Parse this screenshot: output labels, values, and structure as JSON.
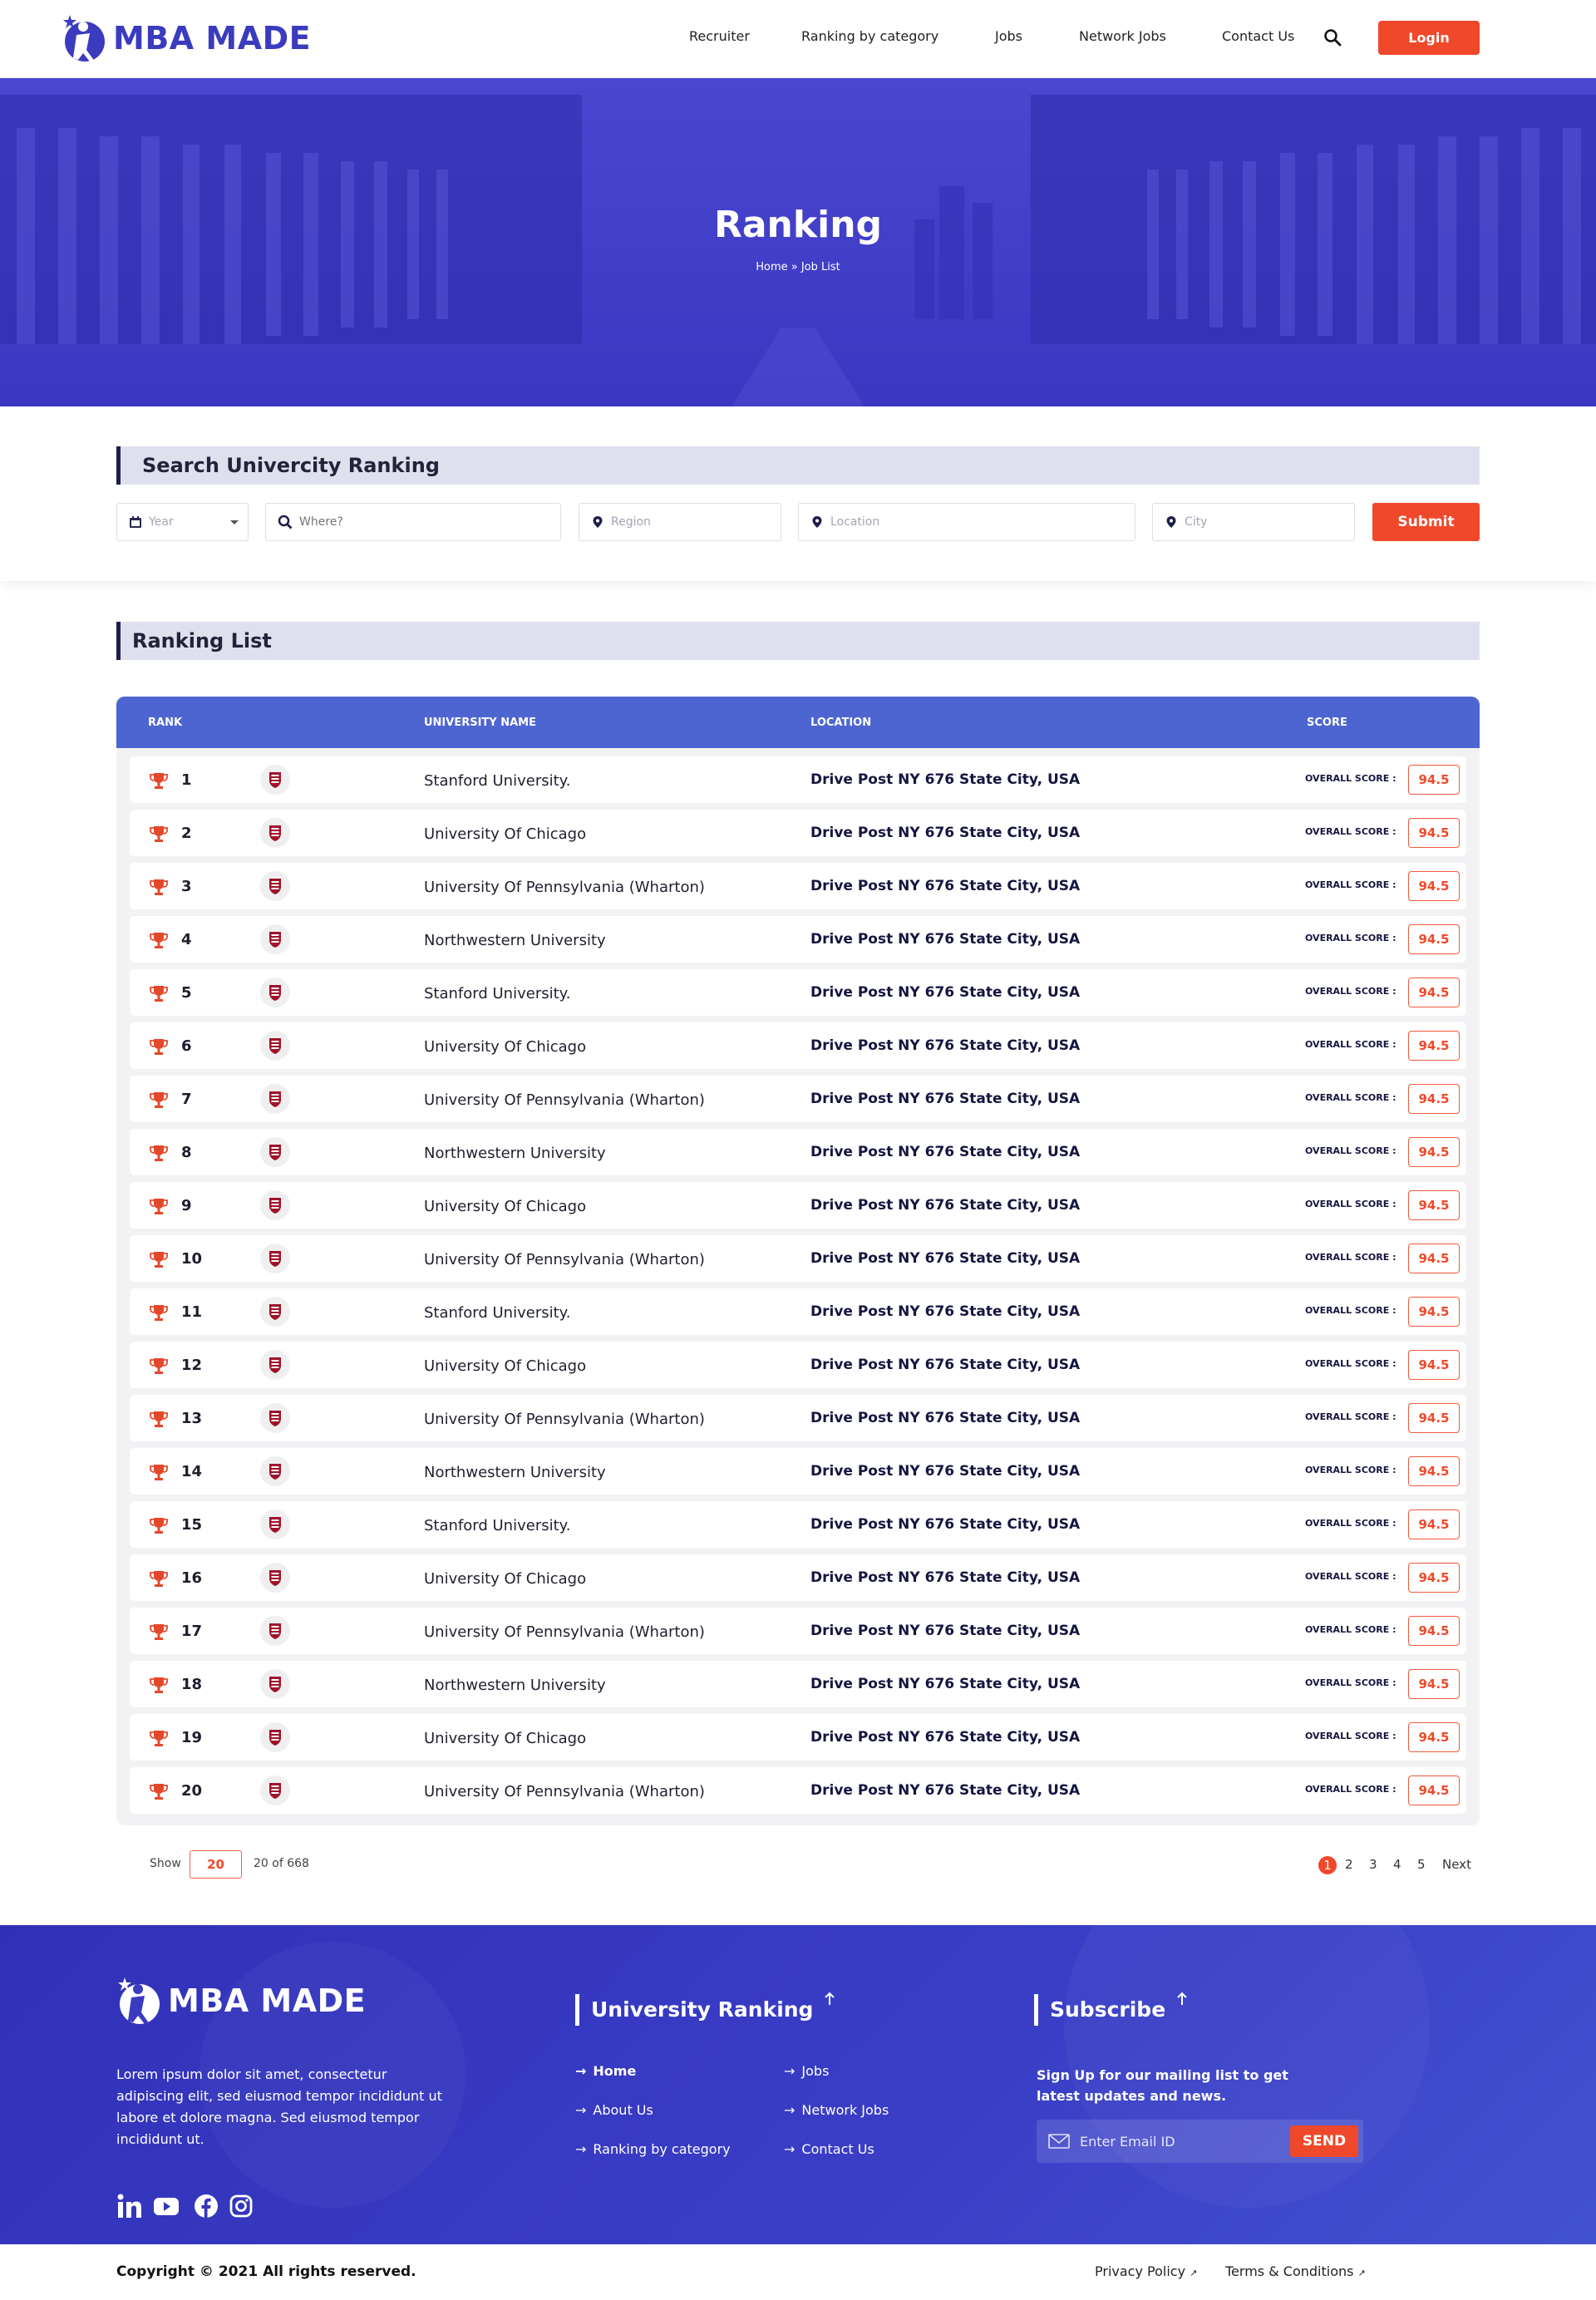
{
  "header": {
    "logo_text": "MBA MADE",
    "nav": [
      "Recruiter",
      "Ranking  by category",
      "Jobs",
      "Network Jobs",
      "Contact Us"
    ],
    "login_label": "Login"
  },
  "hero": {
    "title": "Ranking",
    "breadcrumb": "Home » Job List"
  },
  "search": {
    "title": "Search Univercity Ranking",
    "year_placeholder": "Year",
    "where_placeholder": "Where?",
    "region_placeholder": "Region",
    "location_placeholder": "Location",
    "city_placeholder": "City",
    "submit_label": "Submit"
  },
  "ranking": {
    "title": "Ranking List",
    "columns": [
      "RANK",
      "UNIVERSITY NAME",
      "LOCATION",
      "SCORE"
    ],
    "score_label": "OVERALL SCORE :",
    "rows": [
      {
        "rank": "1",
        "name": "Stanford University.",
        "location": "Drive Post NY 676 State City, USA",
        "score": "94.5"
      },
      {
        "rank": "2",
        "name": "University Of Chicago",
        "location": "Drive Post NY 676 State City, USA",
        "score": "94.5"
      },
      {
        "rank": "3",
        "name": "University Of Pennsylvania (Wharton)",
        "location": "Drive Post NY 676 State City, USA",
        "score": "94.5"
      },
      {
        "rank": "4",
        "name": "Northwestern University",
        "location": "Drive Post NY 676 State City, USA",
        "score": "94.5"
      },
      {
        "rank": "5",
        "name": "Stanford University.",
        "location": "Drive Post NY 676 State City, USA",
        "score": "94.5"
      },
      {
        "rank": "6",
        "name": "University Of Chicago",
        "location": "Drive Post NY 676 State City, USA",
        "score": "94.5"
      },
      {
        "rank": "7",
        "name": "University Of Pennsylvania (Wharton)",
        "location": "Drive Post NY 676 State City, USA",
        "score": "94.5"
      },
      {
        "rank": "8",
        "name": "Northwestern University",
        "location": "Drive Post NY 676 State City, USA",
        "score": "94.5"
      },
      {
        "rank": "9",
        "name": "University Of Chicago",
        "location": "Drive Post NY 676 State City, USA",
        "score": "94.5"
      },
      {
        "rank": "10",
        "name": "University Of Pennsylvania (Wharton)",
        "location": "Drive Post NY 676 State City, USA",
        "score": "94.5"
      },
      {
        "rank": "11",
        "name": "Stanford University.",
        "location": "Drive Post NY 676 State City, USA",
        "score": "94.5"
      },
      {
        "rank": "12",
        "name": "University Of Chicago",
        "location": "Drive Post NY 676 State City, USA",
        "score": "94.5"
      },
      {
        "rank": "13",
        "name": "University Of Pennsylvania (Wharton)",
        "location": "Drive Post NY 676 State City, USA",
        "score": "94.5"
      },
      {
        "rank": "14",
        "name": "Northwestern University",
        "location": "Drive Post NY 676 State City, USA",
        "score": "94.5"
      },
      {
        "rank": "15",
        "name": "Stanford University.",
        "location": "Drive Post NY 676 State City, USA",
        "score": "94.5"
      },
      {
        "rank": "16",
        "name": "University Of Chicago",
        "location": "Drive Post NY 676 State City, USA",
        "score": "94.5"
      },
      {
        "rank": "17",
        "name": "University Of Pennsylvania (Wharton)",
        "location": "Drive Post NY 676 State City, USA",
        "score": "94.5"
      },
      {
        "rank": "18",
        "name": "Northwestern University",
        "location": "Drive Post NY 676 State City, USA",
        "score": "94.5"
      },
      {
        "rank": "19",
        "name": "University Of Chicago",
        "location": "Drive Post NY 676 State City, USA",
        "score": "94.5"
      },
      {
        "rank": "20",
        "name": "University Of Pennsylvania (Wharton)",
        "location": "Drive Post NY 676 State City, USA",
        "score": "94.5"
      }
    ]
  },
  "pagination": {
    "show_label": "Show",
    "show_value": "20",
    "count_text": "20 of 668",
    "pages": [
      "1",
      "2",
      "3",
      "4",
      "5"
    ],
    "active_page": "1",
    "next_label": "Next"
  },
  "footer": {
    "logo_text": "MBA MADE",
    "description": "Lorem ipsum dolor sit amet, consectetur adipiscing elit, sed eiusmod tempor incididunt ut labore et dolore magna. Sed eiusmod tempor incididunt ut.",
    "social_icons": [
      "linkedin-icon",
      "youtube-icon",
      "facebook-icon",
      "instagram-icon"
    ],
    "ranking_title": "University Ranking",
    "links_left": [
      "Home",
      "About Us",
      "Ranking  by category"
    ],
    "links_right": [
      "Jobs",
      "Network Jobs",
      "Contact Us"
    ],
    "subscribe_title": "Subscribe",
    "subscribe_text": "Sign Up for our mailing list to get latest updates and news.",
    "email_placeholder": "Enter Email ID",
    "send_label": "SEND",
    "copyright": "Copyright © 2021 All rights reserved.",
    "privacy_label": "Privacy Policy",
    "terms_label": "Terms & Conditions"
  },
  "colors": {
    "brand_blue": "#3b3bbf",
    "table_header": "#4d65d1",
    "accent_orange": "#f0482a"
  }
}
